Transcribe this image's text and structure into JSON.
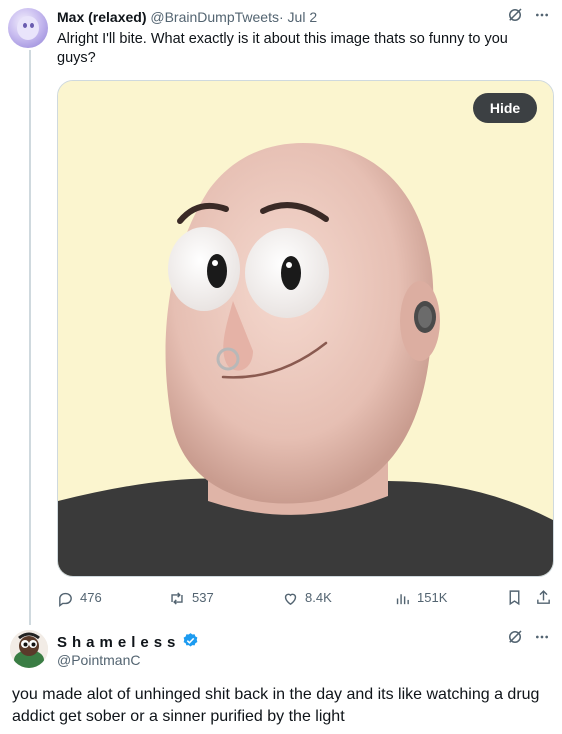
{
  "tweet1": {
    "display_name": "Max (relaxed)",
    "handle": "@BrainDumpTweets",
    "separator": "·",
    "date": "Jul 2",
    "text": "Alright I'll bite. What exactly is it about this image thats so funny to you guys?",
    "media": {
      "hide_label": "Hide"
    },
    "actions": {
      "replies": "476",
      "reposts": "537",
      "likes": "8.4K",
      "views": "151K"
    }
  },
  "tweet2": {
    "display_name": "Shameless",
    "handle": "@PointmanC",
    "text": "you made alot of unhinged shit back in the day and its like watching a drug addict get sober or a sinner purified by the light"
  },
  "colors": {
    "text_primary": "#0f1419",
    "text_secondary": "#536471",
    "verified_blue": "#1d9bf0",
    "media_background": "#fbf5cf",
    "hide_button": "#3c4043"
  },
  "icons": [
    "grok-icon",
    "more-icon",
    "reply-icon",
    "repost-icon",
    "like-icon",
    "views-icon",
    "bookmark-icon",
    "share-icon",
    "verified-badge-icon"
  ]
}
